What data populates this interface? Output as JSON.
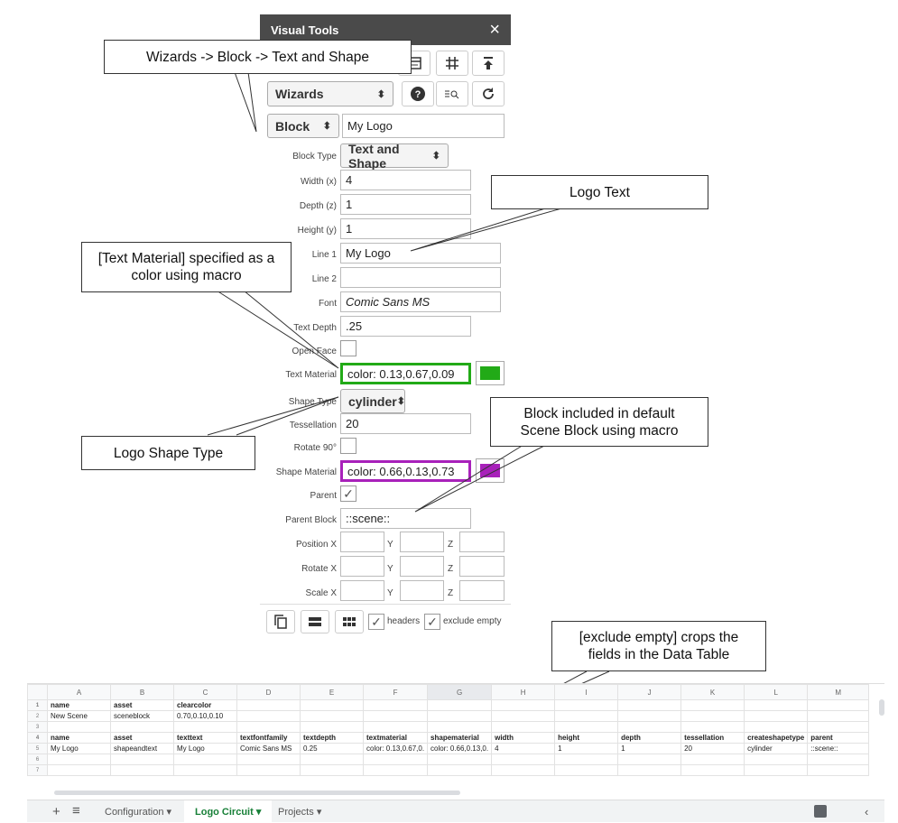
{
  "panel": {
    "title": "Visual Tools",
    "close_icon": "×",
    "toolbar_icons": [
      "table-icon",
      "grid-icon",
      "upload-icon"
    ],
    "wizards_select": "Wizards",
    "toolbar2_icons": [
      "help-icon",
      "zoom-icon",
      "refresh-icon"
    ],
    "block_select": "Block",
    "block_name": "My Logo",
    "fields": {
      "block_type_label": "Block Type",
      "block_type_value": "Text and Shape",
      "width_label": "Width (x)",
      "width_value": "4",
      "depth_label": "Depth (z)",
      "depth_value": "1",
      "height_label": "Height (y)",
      "height_value": "1",
      "line1_label": "Line 1",
      "line1_value": "My Logo",
      "line2_label": "Line 2",
      "line2_value": "",
      "font_label": "Font",
      "font_value": "Comic Sans MS",
      "textdepth_label": "Text Depth",
      "textdepth_value": ".25",
      "openface_label": "Open Face",
      "textmaterial_label": "Text Material",
      "textmaterial_value": "color: 0.13,0.67,0.09",
      "shapetype_label": "Shape Type",
      "shapetype_value": "cylinder",
      "tessellation_label": "Tessellation",
      "tessellation_value": "20",
      "rotate90_label": "Rotate 90°",
      "shapematerial_label": "Shape Material",
      "shapematerial_value": "color: 0.66,0.13,0.73",
      "parent_label": "Parent",
      "parent_check": "✓",
      "parentblock_label": "Parent Block",
      "parentblock_value": "::scene::",
      "position_label": "Position X",
      "rotate_label": "Rotate X",
      "scale_label": "Scale X",
      "y_label": "Y",
      "z_label": "Z"
    },
    "bottom": {
      "headers_label": "headers",
      "exclude_label": "exclude empty",
      "check": "✓"
    },
    "colors": {
      "text_material": "#22aa17",
      "shape_material": "#a821ba",
      "titlebar": "#4a4a4a"
    }
  },
  "callouts": {
    "wizards": "Wizards -> Block -> Text and Shape",
    "logo_text": "Logo Text",
    "text_material": "[Text Material] specified as a color using macro",
    "block_included": "Block included in default Scene Block using macro",
    "logo_shape": "Logo Shape Type",
    "exclude_empty": "[exclude empty] crops the fields in the Data Table"
  },
  "sheet": {
    "columns": [
      "A",
      "B",
      "C",
      "D",
      "E",
      "F",
      "G",
      "H",
      "I",
      "J",
      "K",
      "L",
      "M"
    ],
    "rows": [
      [
        "1",
        "name",
        "asset",
        "clearcolor",
        "",
        "",
        "",
        "",
        "",
        "",
        "",
        "",
        ""
      ],
      [
        "2",
        "New Scene",
        "sceneblock",
        "0.70,0.10,0.10",
        "",
        "",
        "",
        "",
        "",
        "",
        "",
        "",
        ""
      ],
      [
        "3",
        "",
        "",
        "",
        "",
        "",
        "",
        "",
        "",
        "",
        "",
        "",
        ""
      ],
      [
        "4",
        "name",
        "asset",
        "texttext",
        "textfontfamily",
        "textdepth",
        "textmaterial",
        "shapematerial",
        "width",
        "height",
        "depth",
        "tessellation",
        "createshapetype",
        "parent"
      ],
      [
        "5",
        "My Logo",
        "shapeandtext",
        "My Logo",
        "Comic Sans MS",
        "0.25",
        "color: 0.13,0.67,0.",
        "color: 0.66,0.13,0.",
        "4",
        "1",
        "1",
        "20",
        "cylinder",
        "::scene::"
      ],
      [
        "6",
        "",
        "",
        "",
        "",
        "",
        "",
        "",
        "",
        "",
        "",
        "",
        ""
      ],
      [
        "7",
        "",
        "",
        "",
        "",
        "",
        "",
        "",
        "",
        "",
        "",
        "",
        ""
      ]
    ],
    "tabs": {
      "add": "+",
      "menu": "≡",
      "t1": "Configuration",
      "t2": "Logo Circuit",
      "t3": "Projects",
      "caret": "▾"
    }
  }
}
